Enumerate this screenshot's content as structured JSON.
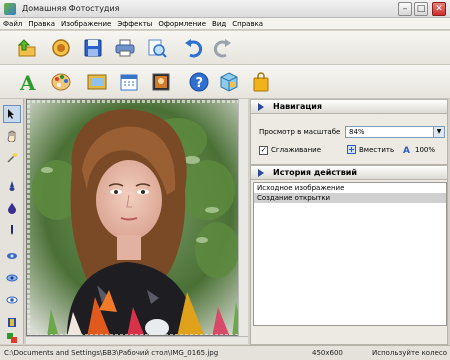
{
  "window": {
    "title": "Домашняя Фотостудия",
    "min_glyph": "–",
    "max_glyph": "□",
    "close_glyph": "✕"
  },
  "menu": [
    "Файл",
    "Правка",
    "Изображение",
    "Эффекты",
    "Оформление",
    "Вид",
    "Справка"
  ],
  "toolbar1": [
    {
      "name": "open-icon",
      "color": "#e0a21b"
    },
    {
      "name": "image-lens-icon",
      "color": "#c98a1d"
    },
    {
      "name": "save-icon",
      "color": "#2a62c9"
    },
    {
      "name": "print-icon",
      "color": "#5a86c8"
    },
    {
      "name": "preview-icon",
      "color": "#4a9fe0"
    },
    {
      "name": "undo-icon",
      "color": "#2d6fd2"
    },
    {
      "name": "redo-icon",
      "color": "#9aa3ad"
    }
  ],
  "toolbar2": [
    {
      "name": "text-icon",
      "color": "#2d9a2d"
    },
    {
      "name": "palette-icon",
      "color": "#e3a53a"
    },
    {
      "name": "frame-icon",
      "color": "#e3b94a"
    },
    {
      "name": "calendar-icon",
      "color": "#3a74c8"
    },
    {
      "name": "collage-icon",
      "color": "#d07b2a"
    },
    {
      "name": "help-icon",
      "color": "#2e6fd0"
    },
    {
      "name": "box-3d-icon",
      "color": "#58a9d8"
    },
    {
      "name": "shopping-bag-icon",
      "color": "#f2b21b"
    }
  ],
  "left_tools": [
    "pointer-icon",
    "hand-icon",
    "magic-wand-icon",
    "brush-icon",
    "drop-icon",
    "pen-icon",
    "stamp-icon",
    "eye-icon",
    "eye-red-icon",
    "layers-icon",
    "color-swatch-icon"
  ],
  "nav": {
    "title": "Навигация",
    "zoom_label": "Просмотр в масштабе",
    "zoom_value": "84%",
    "smooth_label": "Сглаживание",
    "fit_label": "Вместить",
    "actual_label": "100%"
  },
  "history": {
    "title": "История действий",
    "items": [
      "Исходное изображение",
      "Создание открытки"
    ],
    "selected_index": 1
  },
  "status": {
    "path": "C:\\Documents and Settings\\БВЗ\\Рабочий стол\\IMG_0165.jpg",
    "size": "450x600",
    "hint": "Используйте колесо"
  }
}
